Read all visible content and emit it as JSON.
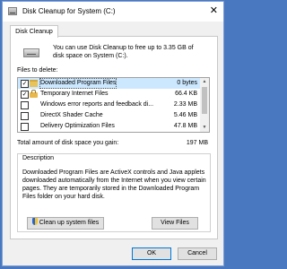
{
  "window": {
    "title": "Disk Cleanup for System (C:)",
    "close_glyph": "✕"
  },
  "tab": {
    "label": "Disk Cleanup"
  },
  "intro": "You can use Disk Cleanup to free up to 3.35 GB of disk space on System (C:).",
  "files_label": "Files to delete:",
  "files": [
    {
      "name": "Downloaded Program Files",
      "size": "0 bytes",
      "checked": true,
      "icon": "folder-icon"
    },
    {
      "name": "Temporary Internet Files",
      "size": "66.4 KB",
      "checked": true,
      "icon": "lock-icon"
    },
    {
      "name": "Windows error reports and feedback di...",
      "size": "2.33 MB",
      "checked": false,
      "icon": "none"
    },
    {
      "name": "DirectX Shader Cache",
      "size": "5.46 MB",
      "checked": false,
      "icon": "none"
    },
    {
      "name": "Delivery Optimization Files",
      "size": "47.8 MB",
      "checked": false,
      "icon": "none"
    }
  ],
  "total": {
    "label": "Total amount of disk space you gain:",
    "value": "197 MB"
  },
  "description": {
    "title": "Description",
    "text": "Downloaded Program Files are ActiveX controls and Java applets downloaded automatically from the Internet when you view certain pages. They are temporarily stored in the Downloaded Program Files folder on your hard disk."
  },
  "buttons": {
    "cleanup": "Clean up system files",
    "view_files": "View Files",
    "ok": "OK",
    "cancel": "Cancel"
  },
  "colors": {
    "selection": "#cce8ff",
    "accent": "#0078d7",
    "desktop": "#4a78c0"
  }
}
